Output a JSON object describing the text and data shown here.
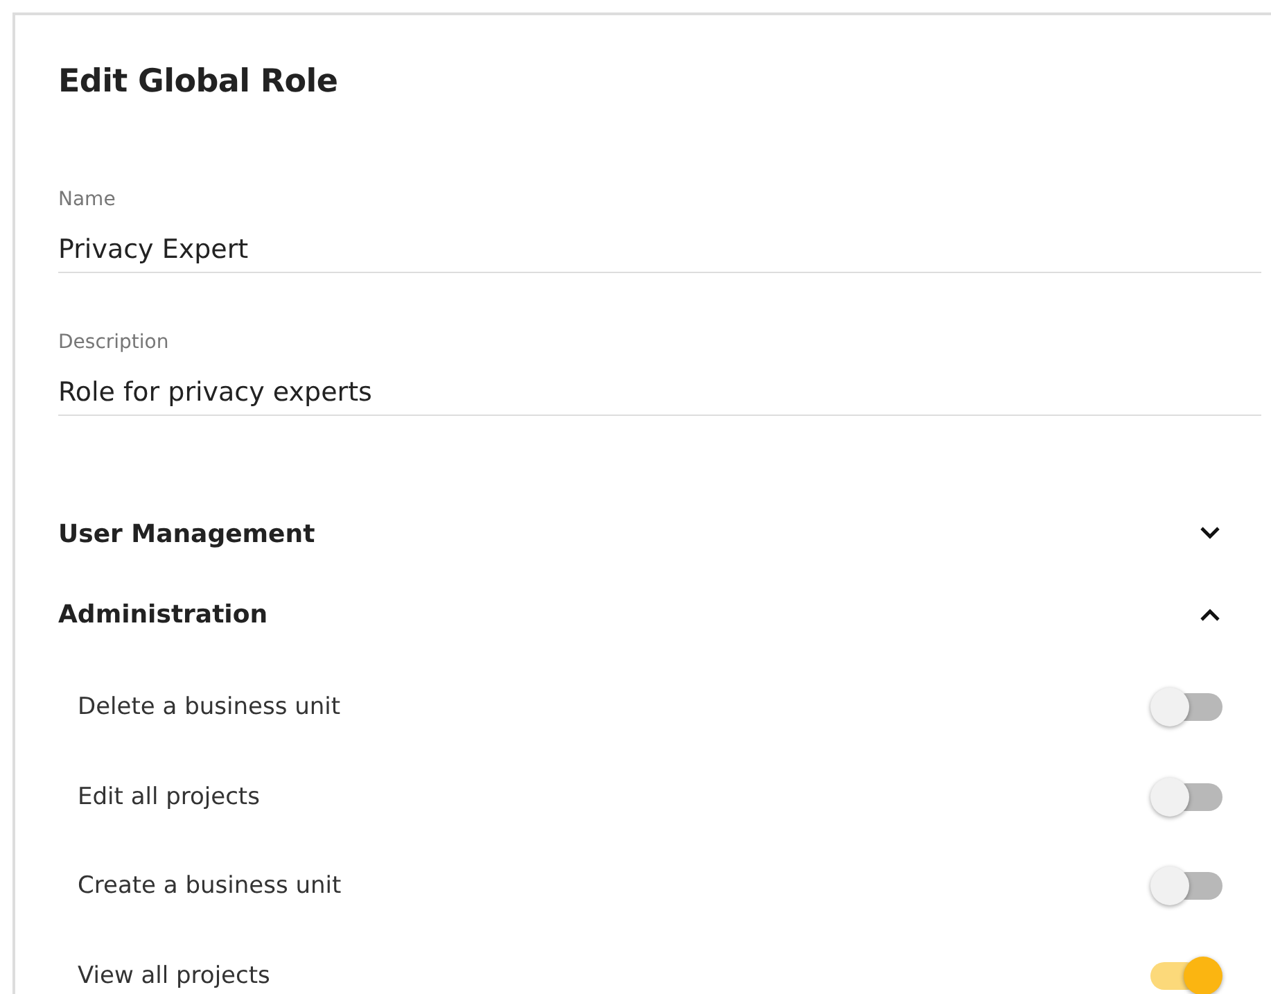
{
  "dialog": {
    "title": "Edit Global Role"
  },
  "fields": [
    {
      "label": "Name",
      "value": "Privacy Expert"
    },
    {
      "label": "Description",
      "value": "Role for privacy experts"
    }
  ],
  "sections": [
    {
      "title": "User Management",
      "expanded": false
    },
    {
      "title": "Administration",
      "expanded": true,
      "permissions": [
        {
          "label": "Delete a business unit",
          "on": false
        },
        {
          "label": "Edit all projects",
          "on": false
        },
        {
          "label": "Create a business unit",
          "on": false
        },
        {
          "label": "View all projects",
          "on": true
        }
      ]
    }
  ]
}
